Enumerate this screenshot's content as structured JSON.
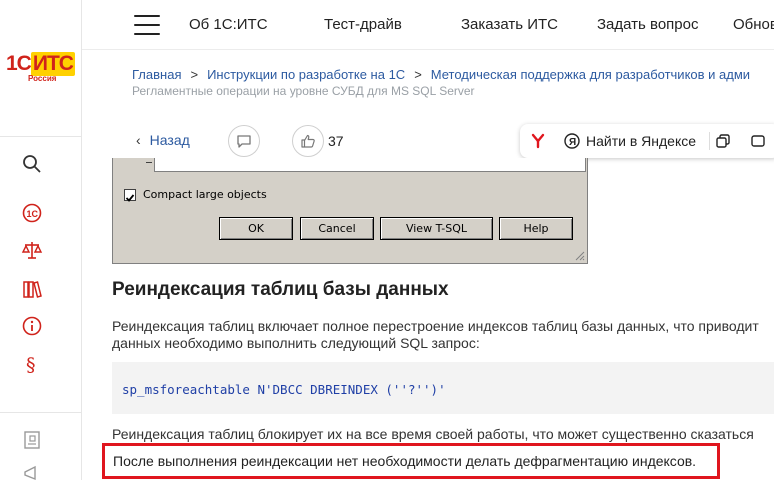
{
  "logo": {
    "text_1c": "1С",
    "text_its": "ИТС",
    "sub": "Россия"
  },
  "header": {
    "nav": [
      "Об 1С:ИТС",
      "Тест-драйв",
      "Заказать ИТС",
      "Задать вопрос",
      "Обнов"
    ]
  },
  "breadcrumb": {
    "items": [
      "Главная",
      "Инструкции по разработке на 1С",
      "Методическая поддержка для разработчиков и адми"
    ],
    "sub": "Регламентные операции на уровне СУБД для MS SQL Server"
  },
  "actions": {
    "back_label": "Назад",
    "likes": "37",
    "yandex_label": "Найти в Яндексе"
  },
  "dialog": {
    "checkbox_label": "Compact large objects",
    "checkbox_checked": true,
    "buttons": [
      "OK",
      "Cancel",
      "View T-SQL",
      "Help"
    ]
  },
  "article": {
    "heading": "Реиндексация таблиц базы данных",
    "para1_line1": "Реиндексация таблиц включает полное перестроение индексов таблиц базы данных, что приводит",
    "para1_line2": "данных необходимо выполнить следующий SQL запрос:",
    "code": "sp_msforeachtable N'DBCC DBREINDEX (''?'')'",
    "para2": "Реиндексация таблиц блокирует их на все время своей работы, что может существенно сказаться",
    "highlight": "После выполнения реиндексации нет необходимости делать дефрагментацию индексов."
  },
  "colors": {
    "brand_red": "#d0231b",
    "link_blue": "#2c5aa0",
    "highlight_red": "#e0161e",
    "code_blue": "#1f3fa6"
  }
}
